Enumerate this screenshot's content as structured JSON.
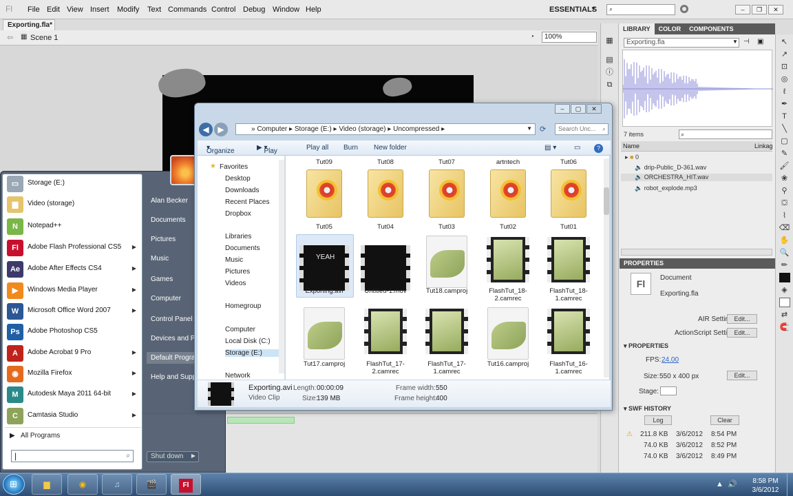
{
  "flash": {
    "logo": "Fl",
    "menus": [
      "File",
      "Edit",
      "View",
      "Insert",
      "Modify",
      "Text",
      "Commands",
      "Control",
      "Debug",
      "Window",
      "Help"
    ],
    "workspace": "ESSENTIALS",
    "doc_tab": "Exporting.fla*",
    "scene": "Scene 1",
    "zoom": "100%"
  },
  "library": {
    "tabs": [
      "LIBRARY",
      "COLOR",
      "COMPONENTS"
    ],
    "selected_doc": "Exporting.fla",
    "item_count": "7 items",
    "col_name": "Name",
    "col_linkage": "Linkag",
    "items": [
      "0",
      "drip-Public_D-361.wav",
      "ORCHESTRA_HIT.wav",
      "robot_explode.mp3"
    ]
  },
  "properties": {
    "header": "PROPERTIES",
    "doc_icon": "Fl",
    "doc_type": "Document",
    "doc_name": "Exporting.fla",
    "air_settings": "AIR Settings",
    "as_settings": "ActionScript Settings",
    "edit": "Edit...",
    "section_props": "PROPERTIES",
    "fps_label": "FPS:",
    "fps": "24.00",
    "size_label": "Size:",
    "size": "550 x 400 px",
    "stage_label": "Stage:",
    "swf_header": "SWF HISTORY",
    "log": "Log",
    "clear": "Clear",
    "history": [
      {
        "size": "211.8 KB",
        "date": "3/6/2012",
        "time": "8:54 PM"
      },
      {
        "size": "74.0 KB",
        "date": "3/6/2012",
        "time": "8:52 PM"
      },
      {
        "size": "74.0 KB",
        "date": "3/6/2012",
        "time": "8:49 PM"
      }
    ]
  },
  "explorer": {
    "breadcrumb": [
      "Computer",
      "Storage (E:)",
      "Video (storage)",
      "Uncompressed"
    ],
    "search_placeholder": "Search Unc...",
    "commands": [
      "Organize",
      "Play",
      "Play all",
      "Burn",
      "New folder"
    ],
    "nav": [
      "Favorites",
      "Desktop",
      "Downloads",
      "Recent Places",
      "Dropbox",
      "Libraries",
      "Documents",
      "Music",
      "Pictures",
      "Videos",
      "Homegroup",
      "Computer",
      "Local Disk (C:)",
      "Storage (E:)",
      "Network"
    ],
    "top_labels": [
      "Tut09",
      "Tut08",
      "Tut07",
      "artntech",
      "Tut06"
    ],
    "row1": [
      "Tut05",
      "Tut04",
      "Tut03",
      "Tut02",
      "Tut01"
    ],
    "row2": [
      "Exporting.avi",
      "Untitled-1.mov",
      "Tut18.camproj",
      "FlashTut_18-2.camrec",
      "FlashTut_18-1.camrec"
    ],
    "row3": [
      "Tut17.camproj",
      "FlashTut_17-2.camrec",
      "FlashTut_17-1.camrec",
      "Tut16.camproj",
      "FlashTut_16-1.camrec"
    ],
    "thumb_text": "YEAH",
    "details": {
      "name": "Exporting.avi",
      "type": "Video Clip",
      "length_label": "Length:",
      "length": "00:00:09",
      "size_label": "Size:",
      "size": "139 MB",
      "fw_label": "Frame width:",
      "fw": "550",
      "fh_label": "Frame height:",
      "fh": "400"
    }
  },
  "start_menu": {
    "programs": [
      {
        "label": "Storage (E:)",
        "icon": "drive-icon",
        "arrow": false
      },
      {
        "label": "Video (storage)",
        "icon": "folder-icon",
        "arrow": false
      },
      {
        "label": "Notepad++",
        "icon": "notepad-icon",
        "arrow": false
      },
      {
        "label": "Adobe Flash Professional CS5",
        "icon": "flash-icon",
        "arrow": true
      },
      {
        "label": "Adobe After Effects CS4",
        "icon": "after-effects-icon",
        "arrow": true
      },
      {
        "label": "Windows Media Player",
        "icon": "media-player-icon",
        "arrow": true
      },
      {
        "label": "Microsoft Office Word 2007",
        "icon": "word-icon",
        "arrow": true
      },
      {
        "label": "Adobe Photoshop CS5",
        "icon": "photoshop-icon",
        "arrow": false
      },
      {
        "label": "Adobe Acrobat 9 Pro",
        "icon": "acrobat-icon",
        "arrow": true
      },
      {
        "label": "Mozilla Firefox",
        "icon": "firefox-icon",
        "arrow": true
      },
      {
        "label": "Autodesk Maya 2011 64-bit",
        "icon": "maya-icon",
        "arrow": true
      },
      {
        "label": "Camtasia Studio",
        "icon": "camtasia-icon",
        "arrow": true
      }
    ],
    "all_programs": "All Programs",
    "right": [
      "Alan Becker",
      "Documents",
      "Pictures",
      "Music",
      "Games",
      "Computer",
      "Control Panel",
      "Devices and Printers",
      "Default Programs",
      "Help and Support"
    ],
    "shutdown": "Shut down"
  },
  "taskbar": {
    "time": "8:58 PM",
    "date": "3/6/2012"
  },
  "colors": {
    "flash_red": "#c8102e",
    "start_blue": "#2d4d73",
    "lib_wave": "#8b8bd8"
  }
}
